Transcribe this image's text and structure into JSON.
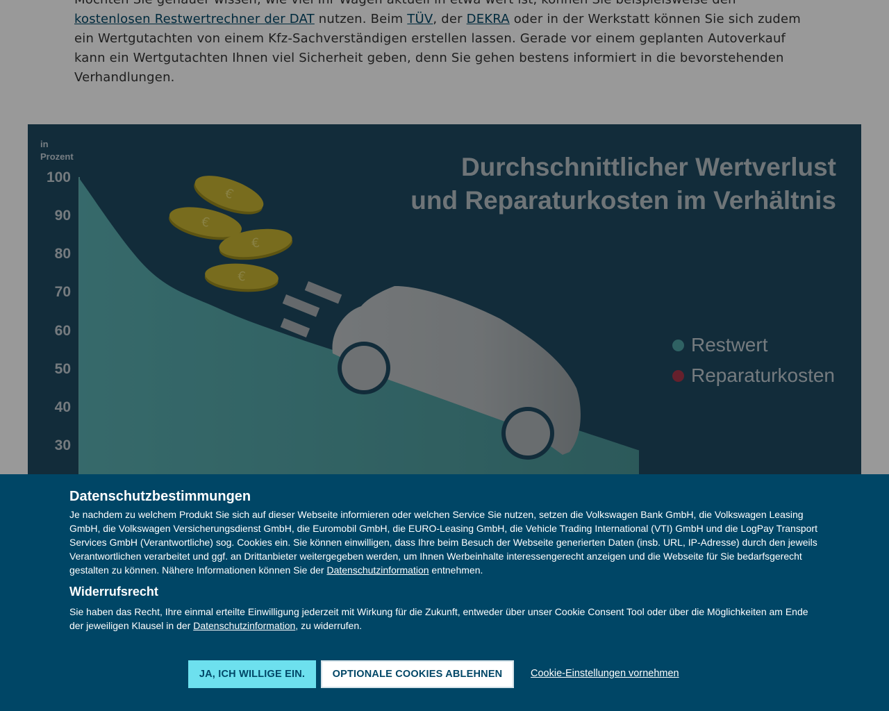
{
  "article": {
    "line1_pre": "Möchten Sie genauer wissen, wie viel Ihr Wagen aktuell in etwa wert ist, können Sie beispielsweise den ",
    "link_dat": "kostenlosen Restwertrechner der DAT",
    "seg_nutzen": " nutzen. Beim ",
    "link_tuev": "TÜV",
    "seg_der": ", der ",
    "link_dekra": "DEKRA",
    "seg_rest": " oder in der Werkstatt können Sie sich zudem ein Wertgutachten von einem Kfz-Sachverständigen erstellen lassen. Gerade vor einem geplanten Autoverkauf kann ein Wertgutachten Ihnen viel Sicherheit geben, denn Sie gehen bestens informiert in die bevorstehenden Verhandlungen."
  },
  "infographic": {
    "title_line1": "Durchschnittlicher Wertverlust",
    "title_line2": "und Reparaturkosten im Verhältnis",
    "y_unit_line1": "in",
    "y_unit_line2": "Prozent",
    "legend": [
      {
        "label": "Restwert",
        "color": "#4fa3a5"
      },
      {
        "label": "Reparaturkosten",
        "color": "#a8364a"
      }
    ],
    "coin_symbol": "€",
    "colors": {
      "background": "#1f4a62",
      "area": "#4fa3a5",
      "car": "#a9b0b4",
      "coin": "#c9b533"
    }
  },
  "chart_data": {
    "type": "area",
    "y_unit": "in Prozent",
    "y_ticks": [
      100,
      90,
      80,
      70,
      60,
      50,
      40,
      30
    ],
    "ylim": [
      25,
      100
    ],
    "series": [
      {
        "name": "Restwert",
        "x": [
          0,
          1,
          2,
          3,
          4,
          5,
          6,
          7,
          8
        ],
        "values": [
          100,
          76,
          66,
          59,
          53,
          47,
          41,
          35,
          29
        ]
      }
    ]
  },
  "consent": {
    "title": "Datenschutzbestimmungen",
    "text1_pre": "Je nachdem zu welchem Produkt Sie sich auf dieser Webseite informieren oder welchen Service Sie nutzen, setzen die Volkswagen Bank GmbH, die Volkswagen Leasing GmbH, die Volkswagen Versicherungsdienst GmbH, die Euromobil GmbH, die EURO-Leasing GmbH, die Vehicle Trading International (VTI) GmbH und die LogPay Transport Services GmbH (Verantwortliche) sog. Cookies ein. Sie können einwilligen, dass Ihre beim Besuch der Webseite generierten Daten (insb. URL, IP-Adresse) durch den jeweils Verantwortlichen verarbeitet und ggf. an Drittanbieter weitergegeben werden, um Ihnen Werbeinhalte interessengerecht anzeigen und die Webseite für Sie bedarfsgerecht gestalten zu können. Nähere Informationen können Sie der ",
    "link_info": "Datenschutzinformation",
    "text1_post": " entnehmen.",
    "subtitle": "Widerrufsrecht",
    "text2_pre": "Sie haben das Recht, Ihre einmal erteilte Einwilligung jederzeit mit Wirkung für die Zukunft, entweder über unser Cookie Consent Tool oder über die Möglichkeiten am Ende der jeweiligen Klausel in der ",
    "text2_post": ", zu widerrufen.",
    "btn_accept": "JA, ICH WILLIGE EIN.",
    "btn_reject": "OPTIONALE COOKIES ABLEHNEN",
    "link_settings": "Cookie-Einstellungen vornehmen"
  }
}
